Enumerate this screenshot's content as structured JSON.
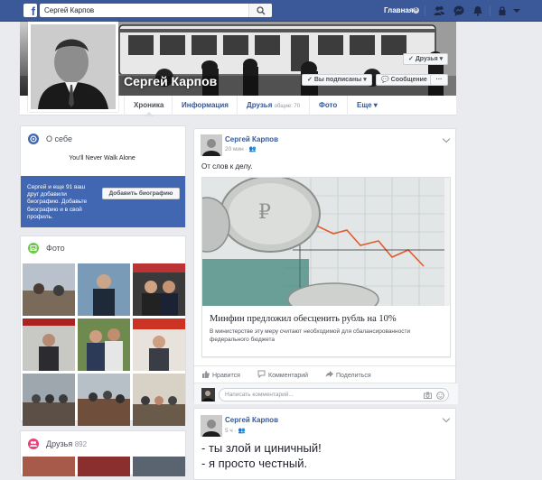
{
  "topbar": {
    "logo": "f",
    "search_value": "Сергей Карпов",
    "search_icon": "search-icon",
    "home_label": "Главная",
    "home_badge": "6",
    "icons": [
      "friends-icon",
      "messages-icon",
      "notifications-icon",
      "privacy-icon",
      "menu-icon"
    ]
  },
  "profile": {
    "name": "Сергей Карпов",
    "friends_button": "Друзья",
    "following_button": "Вы подписаны",
    "message_button": "Сообщение",
    "more_button": "···"
  },
  "tabs": [
    {
      "label": "Хроника"
    },
    {
      "label": "Информация"
    },
    {
      "label": "Друзья",
      "sub": "общие: 70"
    },
    {
      "label": "Фото"
    },
    {
      "label": "Еще"
    }
  ],
  "about": {
    "title": "О себе",
    "motto": "You'll Never Walk Alone",
    "bio_prompt": "Сергей и еще 91 ваш друг добавили биографию. Добавьте биографию и в свой профиль.",
    "bio_button": "Добавить биографию"
  },
  "photos": {
    "title": "Фото"
  },
  "friends": {
    "title": "Друзья",
    "count": "892"
  },
  "post1": {
    "author": "Сергей Карпов",
    "time": "20 мин",
    "text": "От слов к делу.",
    "link_title": "Минфин предложил обесценить рубль на 10%",
    "link_desc": "В министерстве эту меру считают необходимой для сбалансированности федерального бюджета",
    "like": "Нравится",
    "comment": "Комментарий",
    "share": "Поделиться",
    "comment_placeholder": "Написать комментарий..."
  },
  "post2": {
    "author": "Сергей Карпов",
    "time": "5 ч",
    "line1": "- ты злой и циничный!",
    "line2": "- я просто честный."
  },
  "colors": {
    "brand": "#3b5998",
    "link": "#365899",
    "bio_bg": "#4267b2",
    "photos_icon": "#6bca4b",
    "friends_icon": "#e9417a",
    "about_icon": "#4267b2"
  }
}
